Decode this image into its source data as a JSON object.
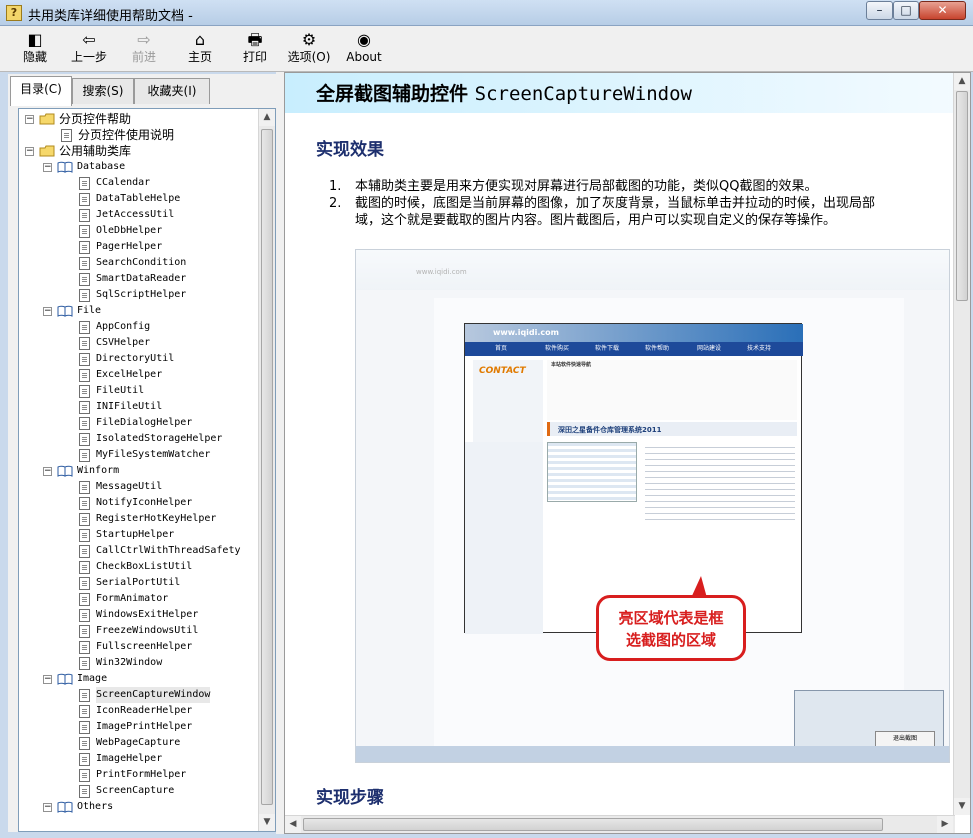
{
  "window": {
    "title": "共用类库详细使用帮助文档 -",
    "app_icon": "?",
    "min": "–",
    "max": "□",
    "close": "✕"
  },
  "toolbar": {
    "buttons": [
      {
        "label": "隐藏",
        "icon": "hide-icon",
        "glyph": "◧"
      },
      {
        "label": "上一步",
        "icon": "back-arrow-icon",
        "glyph": "⇦"
      },
      {
        "label": "前进",
        "icon": "forward-arrow-icon",
        "glyph": "⇨"
      },
      {
        "label": "主页",
        "icon": "home-icon",
        "glyph": "⌂"
      },
      {
        "label": "打印",
        "icon": "print-icon",
        "glyph": "🖶"
      },
      {
        "label": "选项(O)",
        "icon": "options-icon",
        "glyph": "⚙"
      },
      {
        "label": "About",
        "icon": "about-icon",
        "glyph": "◉"
      }
    ]
  },
  "tabs": [
    "目录(C)",
    "搜索(S)",
    "收藏夹(I)"
  ],
  "tree": [
    {
      "label": "分页控件帮助",
      "level": 0,
      "kind": "book",
      "expanded": true
    },
    {
      "label": "分页控件使用说明",
      "level": 1,
      "kind": "page"
    },
    {
      "label": "公用辅助类库",
      "level": 0,
      "kind": "book",
      "expanded": true
    },
    {
      "label": "Database",
      "level": 1,
      "kind": "book",
      "expanded": true
    },
    {
      "label": "CCalendar",
      "level": 2,
      "kind": "page"
    },
    {
      "label": "DataTableHelpe",
      "level": 2,
      "kind": "page"
    },
    {
      "label": "JetAccessUtil",
      "level": 2,
      "kind": "page"
    },
    {
      "label": "OleDbHelper",
      "level": 2,
      "kind": "page"
    },
    {
      "label": "PagerHelper",
      "level": 2,
      "kind": "page"
    },
    {
      "label": "SearchCondition",
      "level": 2,
      "kind": "page"
    },
    {
      "label": "SmartDataReader",
      "level": 2,
      "kind": "page"
    },
    {
      "label": "SqlScriptHelper",
      "level": 2,
      "kind": "page"
    },
    {
      "label": "File",
      "level": 1,
      "kind": "book",
      "expanded": true
    },
    {
      "label": "AppConfig",
      "level": 2,
      "kind": "page"
    },
    {
      "label": "CSVHelper",
      "level": 2,
      "kind": "page"
    },
    {
      "label": "DirectoryUtil",
      "level": 2,
      "kind": "page"
    },
    {
      "label": "ExcelHelper",
      "level": 2,
      "kind": "page"
    },
    {
      "label": "FileUtil",
      "level": 2,
      "kind": "page"
    },
    {
      "label": "INIFileUtil",
      "level": 2,
      "kind": "page"
    },
    {
      "label": "FileDialogHelper",
      "level": 2,
      "kind": "page"
    },
    {
      "label": "IsolatedStorageHelper",
      "level": 2,
      "kind": "page"
    },
    {
      "label": "MyFileSystemWatcher",
      "level": 2,
      "kind": "page"
    },
    {
      "label": "Winform",
      "level": 1,
      "kind": "book",
      "expanded": true
    },
    {
      "label": "MessageUtil",
      "level": 2,
      "kind": "page"
    },
    {
      "label": "NotifyIconHelper",
      "level": 2,
      "kind": "page"
    },
    {
      "label": "RegisterHotKeyHelper",
      "level": 2,
      "kind": "page"
    },
    {
      "label": "StartupHelper",
      "level": 2,
      "kind": "page"
    },
    {
      "label": "CallCtrlWithThreadSafety",
      "level": 2,
      "kind": "page"
    },
    {
      "label": "CheckBoxListUtil",
      "level": 2,
      "kind": "page"
    },
    {
      "label": "SerialPortUtil",
      "level": 2,
      "kind": "page"
    },
    {
      "label": "FormAnimator",
      "level": 2,
      "kind": "page"
    },
    {
      "label": "WindowsExitHelper",
      "level": 2,
      "kind": "page"
    },
    {
      "label": "FreezeWindowsUtil",
      "level": 2,
      "kind": "page"
    },
    {
      "label": "FullscreenHelper",
      "level": 2,
      "kind": "page"
    },
    {
      "label": "Win32Window",
      "level": 2,
      "kind": "page"
    },
    {
      "label": "Image",
      "level": 1,
      "kind": "book",
      "expanded": true
    },
    {
      "label": "ScreenCaptureWindow",
      "level": 2,
      "kind": "page",
      "selected": true
    },
    {
      "label": "IconReaderHelper",
      "level": 2,
      "kind": "page"
    },
    {
      "label": "ImagePrintHelper",
      "level": 2,
      "kind": "page"
    },
    {
      "label": "WebPageCapture",
      "level": 2,
      "kind": "page"
    },
    {
      "label": "ImageHelper",
      "level": 2,
      "kind": "page"
    },
    {
      "label": "PrintFormHelper",
      "level": 2,
      "kind": "page"
    },
    {
      "label": "ScreenCapture",
      "level": 2,
      "kind": "page"
    },
    {
      "label": "Others",
      "level": 1,
      "kind": "book",
      "expanded": true
    }
  ],
  "content": {
    "title_cn": "全屏截图辅助控件 ",
    "title_en": "ScreenCaptureWindow",
    "section1": "实现效果",
    "items": [
      {
        "num": "1.",
        "lines": [
          "本辅助类主要是用来方便实现对屏幕进行局部截图的功能，类似QQ截图的效果。"
        ]
      },
      {
        "num": "2.",
        "lines": [
          "截图的时候，底图是当前屏幕的图像，加了灰度背景，当鼠标单击并拉动的时候，出现局部",
          "域，这个就是要截取的图片内容。图片截图后，用户可以实现自定义的保存等操作。"
        ]
      }
    ],
    "screenshot": {
      "site_name": "www.iqidi.com",
      "nav": [
        "首页",
        "软件购买",
        "软件下载",
        "软件帮助",
        "网站建设",
        "技术支持",
        "联系方式"
      ],
      "contact": "CONTACT",
      "links_title": "本站软件快速导航",
      "article_title": "深田之星备件仓库管理系统2011",
      "popup_button": "退出截图",
      "callout_line1": "亮区域代表是框",
      "callout_line2": "选截图的区域"
    },
    "section2": "实现步骤"
  },
  "colors": {
    "heading": "#1d2f6e",
    "header_band": "#c8eefe",
    "callout": "#d81e1e"
  }
}
